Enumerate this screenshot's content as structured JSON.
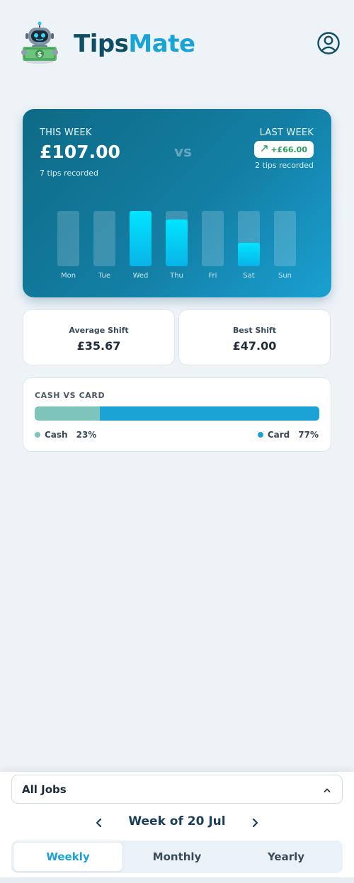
{
  "app": {
    "brand_part1": "Tips",
    "brand_part2": "Mate",
    "brand_colors": {
      "dark": "#0e4f66",
      "accent": "#1aa3d6"
    }
  },
  "week_card": {
    "this_week_label": "THIS WEEK",
    "this_week_amount": "£107.00",
    "this_week_count": "7 tips recorded",
    "vs_label": "vs",
    "last_week_label": "LAST WEEK",
    "diff_badge": "+£66.00",
    "diff_icon": "trend-up-icon",
    "last_week_count": "2 tips recorded",
    "days": [
      {
        "label": "Mon",
        "fill": 0
      },
      {
        "label": "Tue",
        "fill": 0
      },
      {
        "label": "Wed",
        "fill": 1.0
      },
      {
        "label": "Thu",
        "fill": 0.85
      },
      {
        "label": "Fri",
        "fill": 0
      },
      {
        "label": "Sat",
        "fill": 0.42
      },
      {
        "label": "Sun",
        "fill": 0
      }
    ]
  },
  "stats": {
    "average_title": "Average Shift",
    "average_value": "£35.67",
    "best_title": "Best Shift",
    "best_value": "£47.00"
  },
  "split": {
    "title": "CASH VS CARD",
    "cash_label": "Cash",
    "cash_pct": "23%",
    "cash_fraction": 0.23,
    "card_label": "Card",
    "card_pct": "77%",
    "card_fraction": 0.77,
    "cash_color": "#7fc4bb",
    "card_color": "#1ca3d6"
  },
  "controls": {
    "job_value": "All Jobs",
    "week_label": "Week of 20 Jul",
    "tabs": [
      {
        "label": "Weekly",
        "active": true
      },
      {
        "label": "Monthly",
        "active": false
      },
      {
        "label": "Yearly",
        "active": false
      }
    ]
  }
}
